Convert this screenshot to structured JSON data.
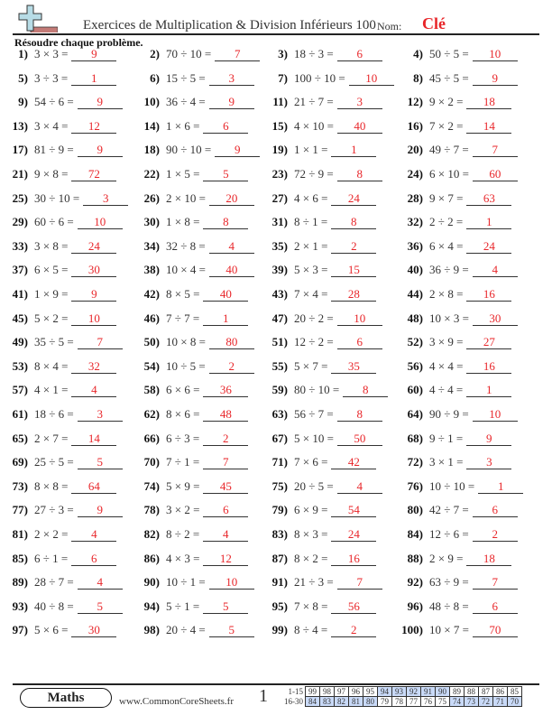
{
  "header": {
    "logo_icon": "plus-minus-logo-icon",
    "title": "Exercices de Multiplication & Division Inférieurs 100",
    "name_label": "Nom:",
    "name_value": "Clé"
  },
  "instructions": "Résoudre chaque problème.",
  "problems": [
    {
      "num": "1)",
      "expr": "3 × 3 =",
      "answer": "9"
    },
    {
      "num": "2)",
      "expr": "70 ÷ 10 =",
      "answer": "7"
    },
    {
      "num": "3)",
      "expr": "18 ÷ 3 =",
      "answer": "6"
    },
    {
      "num": "4)",
      "expr": "50 ÷ 5 =",
      "answer": "10"
    },
    {
      "num": "5)",
      "expr": "3 ÷ 3 =",
      "answer": "1"
    },
    {
      "num": "6)",
      "expr": "15 ÷ 5 =",
      "answer": "3"
    },
    {
      "num": "7)",
      "expr": "100 ÷ 10 =",
      "answer": "10"
    },
    {
      "num": "8)",
      "expr": "45 ÷ 5 =",
      "answer": "9"
    },
    {
      "num": "9)",
      "expr": "54 ÷ 6 =",
      "answer": "9"
    },
    {
      "num": "10)",
      "expr": "36 ÷ 4 =",
      "answer": "9"
    },
    {
      "num": "11)",
      "expr": "21 ÷ 7 =",
      "answer": "3"
    },
    {
      "num": "12)",
      "expr": "9 × 2 =",
      "answer": "18"
    },
    {
      "num": "13)",
      "expr": "3 × 4 =",
      "answer": "12"
    },
    {
      "num": "14)",
      "expr": "1 × 6 =",
      "answer": "6"
    },
    {
      "num": "15)",
      "expr": "4 × 10 =",
      "answer": "40"
    },
    {
      "num": "16)",
      "expr": "7 × 2 =",
      "answer": "14"
    },
    {
      "num": "17)",
      "expr": "81 ÷ 9 =",
      "answer": "9"
    },
    {
      "num": "18)",
      "expr": "90 ÷ 10 =",
      "answer": "9"
    },
    {
      "num": "19)",
      "expr": "1 × 1 =",
      "answer": "1"
    },
    {
      "num": "20)",
      "expr": "49 ÷ 7 =",
      "answer": "7"
    },
    {
      "num": "21)",
      "expr": "9 × 8 =",
      "answer": "72"
    },
    {
      "num": "22)",
      "expr": "1 × 5 =",
      "answer": "5"
    },
    {
      "num": "23)",
      "expr": "72 ÷ 9 =",
      "answer": "8"
    },
    {
      "num": "24)",
      "expr": "6 × 10 =",
      "answer": "60"
    },
    {
      "num": "25)",
      "expr": "30 ÷ 10 =",
      "answer": "3"
    },
    {
      "num": "26)",
      "expr": "2 × 10 =",
      "answer": "20"
    },
    {
      "num": "27)",
      "expr": "4 × 6 =",
      "answer": "24"
    },
    {
      "num": "28)",
      "expr": "9 × 7 =",
      "answer": "63"
    },
    {
      "num": "29)",
      "expr": "60 ÷ 6 =",
      "answer": "10"
    },
    {
      "num": "30)",
      "expr": "1 × 8 =",
      "answer": "8"
    },
    {
      "num": "31)",
      "expr": "8 ÷ 1 =",
      "answer": "8"
    },
    {
      "num": "32)",
      "expr": "2 ÷ 2 =",
      "answer": "1"
    },
    {
      "num": "33)",
      "expr": "3 × 8 =",
      "answer": "24"
    },
    {
      "num": "34)",
      "expr": "32 ÷ 8 =",
      "answer": "4"
    },
    {
      "num": "35)",
      "expr": "2 × 1 =",
      "answer": "2"
    },
    {
      "num": "36)",
      "expr": "6 × 4 =",
      "answer": "24"
    },
    {
      "num": "37)",
      "expr": "6 × 5 =",
      "answer": "30"
    },
    {
      "num": "38)",
      "expr": "10 × 4 =",
      "answer": "40"
    },
    {
      "num": "39)",
      "expr": "5 × 3 =",
      "answer": "15"
    },
    {
      "num": "40)",
      "expr": "36 ÷ 9 =",
      "answer": "4"
    },
    {
      "num": "41)",
      "expr": "1 × 9 =",
      "answer": "9"
    },
    {
      "num": "42)",
      "expr": "8 × 5 =",
      "answer": "40"
    },
    {
      "num": "43)",
      "expr": "7 × 4 =",
      "answer": "28"
    },
    {
      "num": "44)",
      "expr": "2 × 8 =",
      "answer": "16"
    },
    {
      "num": "45)",
      "expr": "5 × 2 =",
      "answer": "10"
    },
    {
      "num": "46)",
      "expr": "7 ÷ 7 =",
      "answer": "1"
    },
    {
      "num": "47)",
      "expr": "20 ÷ 2 =",
      "answer": "10"
    },
    {
      "num": "48)",
      "expr": "10 × 3 =",
      "answer": "30"
    },
    {
      "num": "49)",
      "expr": "35 ÷ 5 =",
      "answer": "7"
    },
    {
      "num": "50)",
      "expr": "10 × 8 =",
      "answer": "80"
    },
    {
      "num": "51)",
      "expr": "12 ÷ 2 =",
      "answer": "6"
    },
    {
      "num": "52)",
      "expr": "3 × 9 =",
      "answer": "27"
    },
    {
      "num": "53)",
      "expr": "8 × 4 =",
      "answer": "32"
    },
    {
      "num": "54)",
      "expr": "10 ÷ 5 =",
      "answer": "2"
    },
    {
      "num": "55)",
      "expr": "5 × 7 =",
      "answer": "35"
    },
    {
      "num": "56)",
      "expr": "4 × 4 =",
      "answer": "16"
    },
    {
      "num": "57)",
      "expr": "4 × 1 =",
      "answer": "4"
    },
    {
      "num": "58)",
      "expr": "6 × 6 =",
      "answer": "36"
    },
    {
      "num": "59)",
      "expr": "80 ÷ 10 =",
      "answer": "8"
    },
    {
      "num": "60)",
      "expr": "4 ÷ 4 =",
      "answer": "1"
    },
    {
      "num": "61)",
      "expr": "18 ÷ 6 =",
      "answer": "3"
    },
    {
      "num": "62)",
      "expr": "8 × 6 =",
      "answer": "48"
    },
    {
      "num": "63)",
      "expr": "56 ÷ 7 =",
      "answer": "8"
    },
    {
      "num": "64)",
      "expr": "90 ÷ 9 =",
      "answer": "10"
    },
    {
      "num": "65)",
      "expr": "2 × 7 =",
      "answer": "14"
    },
    {
      "num": "66)",
      "expr": "6 ÷ 3 =",
      "answer": "2"
    },
    {
      "num": "67)",
      "expr": "5 × 10 =",
      "answer": "50"
    },
    {
      "num": "68)",
      "expr": "9 ÷ 1 =",
      "answer": "9"
    },
    {
      "num": "69)",
      "expr": "25 ÷ 5 =",
      "answer": "5"
    },
    {
      "num": "70)",
      "expr": "7 ÷ 1 =",
      "answer": "7"
    },
    {
      "num": "71)",
      "expr": "7 × 6 =",
      "answer": "42"
    },
    {
      "num": "72)",
      "expr": "3 × 1 =",
      "answer": "3"
    },
    {
      "num": "73)",
      "expr": "8 × 8 =",
      "answer": "64"
    },
    {
      "num": "74)",
      "expr": "5 × 9 =",
      "answer": "45"
    },
    {
      "num": "75)",
      "expr": "20 ÷ 5 =",
      "answer": "4"
    },
    {
      "num": "76)",
      "expr": "10 ÷ 10 =",
      "answer": "1"
    },
    {
      "num": "77)",
      "expr": "27 ÷ 3 =",
      "answer": "9"
    },
    {
      "num": "78)",
      "expr": "3 × 2 =",
      "answer": "6"
    },
    {
      "num": "79)",
      "expr": "6 × 9 =",
      "answer": "54"
    },
    {
      "num": "80)",
      "expr": "42 ÷ 7 =",
      "answer": "6"
    },
    {
      "num": "81)",
      "expr": "2 × 2 =",
      "answer": "4"
    },
    {
      "num": "82)",
      "expr": "8 ÷ 2 =",
      "answer": "4"
    },
    {
      "num": "83)",
      "expr": "8 × 3 =",
      "answer": "24"
    },
    {
      "num": "84)",
      "expr": "12 ÷ 6 =",
      "answer": "2"
    },
    {
      "num": "85)",
      "expr": "6 ÷ 1 =",
      "answer": "6"
    },
    {
      "num": "86)",
      "expr": "4 × 3 =",
      "answer": "12"
    },
    {
      "num": "87)",
      "expr": "8 × 2 =",
      "answer": "16"
    },
    {
      "num": "88)",
      "expr": "2 × 9 =",
      "answer": "18"
    },
    {
      "num": "89)",
      "expr": "28 ÷ 7 =",
      "answer": "4"
    },
    {
      "num": "90)",
      "expr": "10 ÷ 1 =",
      "answer": "10"
    },
    {
      "num": "91)",
      "expr": "21 ÷ 3 =",
      "answer": "7"
    },
    {
      "num": "92)",
      "expr": "63 ÷ 9 =",
      "answer": "7"
    },
    {
      "num": "93)",
      "expr": "40 ÷ 8 =",
      "answer": "5"
    },
    {
      "num": "94)",
      "expr": "5 ÷ 1 =",
      "answer": "5"
    },
    {
      "num": "95)",
      "expr": "7 × 8 =",
      "answer": "56"
    },
    {
      "num": "96)",
      "expr": "48 ÷ 8 =",
      "answer": "6"
    },
    {
      "num": "97)",
      "expr": "5 × 6 =",
      "answer": "30"
    },
    {
      "num": "98)",
      "expr": "20 ÷ 4 =",
      "answer": "5"
    },
    {
      "num": "99)",
      "expr": "8 ÷ 4 =",
      "answer": "2"
    },
    {
      "num": "100)",
      "expr": "10 × 7 =",
      "answer": "70"
    }
  ],
  "footer": {
    "badge": "Maths",
    "url": "www.CommonCoreSheets.fr",
    "page_number": "1",
    "score_rows": [
      {
        "label": "1-15",
        "values": [
          "99",
          "98",
          "97",
          "96",
          "95",
          "94",
          "93",
          "92",
          "91",
          "90",
          "89",
          "88",
          "87",
          "86",
          "85"
        ],
        "highlight": [
          false,
          false,
          false,
          false,
          false,
          true,
          true,
          true,
          true,
          true,
          false,
          false,
          false,
          false,
          false
        ]
      },
      {
        "label": "16-30",
        "values": [
          "84",
          "83",
          "82",
          "81",
          "80",
          "79",
          "78",
          "77",
          "76",
          "75",
          "74",
          "73",
          "72",
          "71",
          "70"
        ],
        "highlight": [
          true,
          true,
          true,
          true,
          true,
          false,
          false,
          false,
          false,
          false,
          true,
          true,
          true,
          true,
          true
        ]
      }
    ],
    "highlight_color": "#c9daf8"
  }
}
